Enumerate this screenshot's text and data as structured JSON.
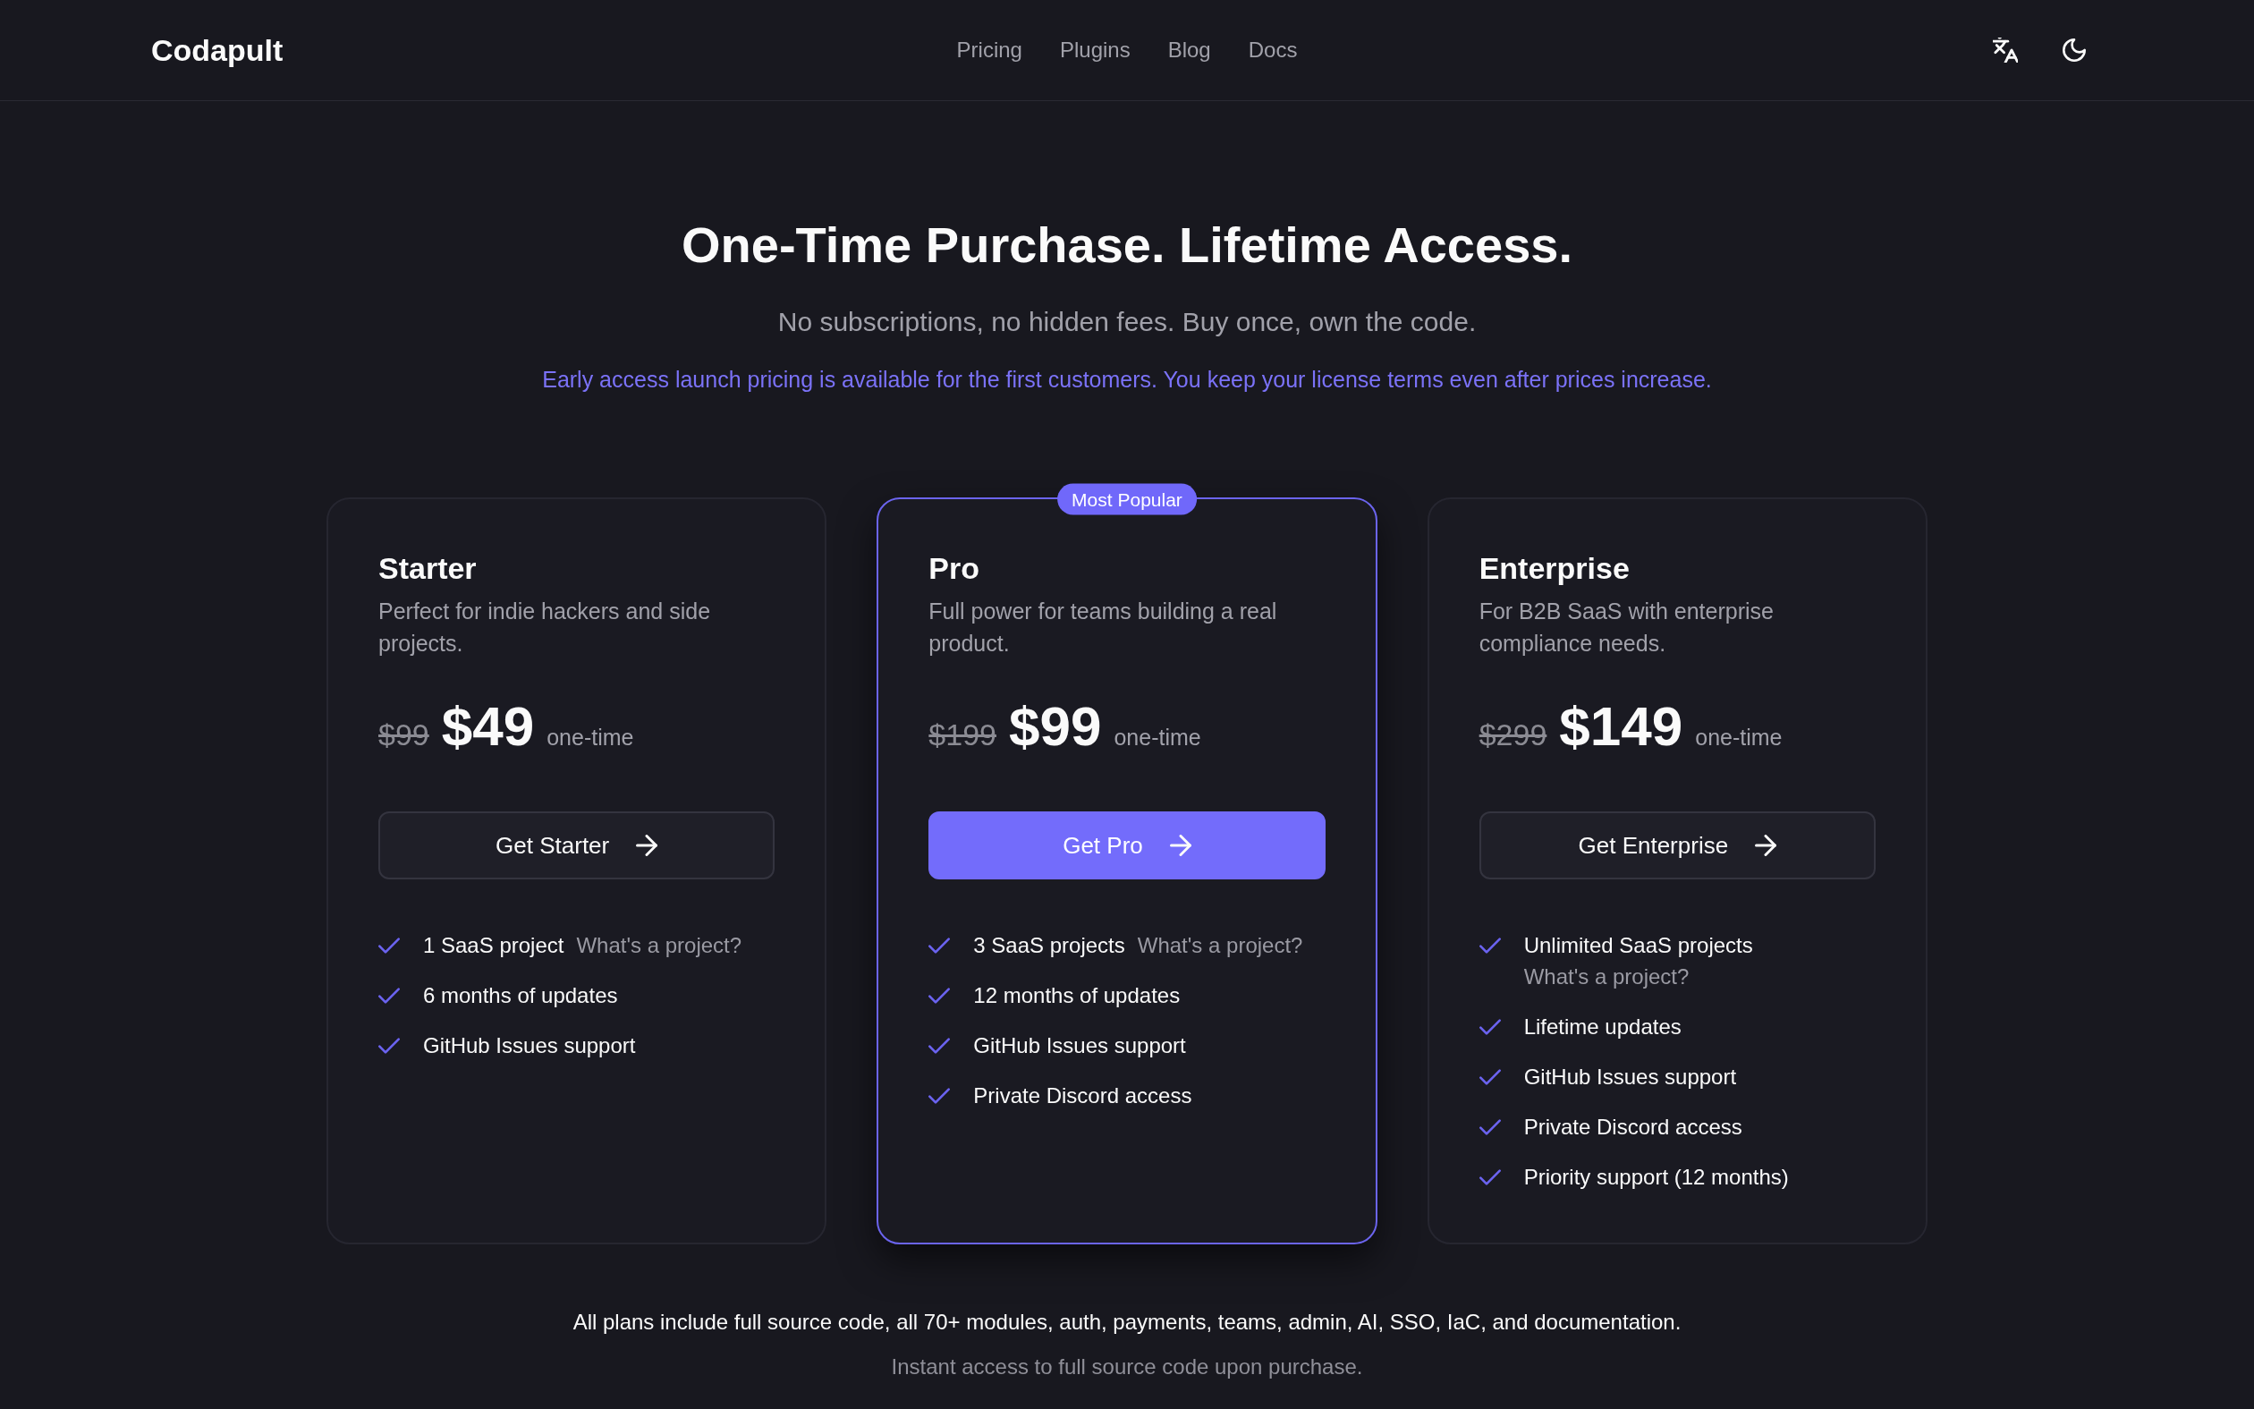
{
  "header": {
    "logo": "Codapult",
    "nav": [
      {
        "label": "Pricing"
      },
      {
        "label": "Plugins"
      },
      {
        "label": "Blog"
      },
      {
        "label": "Docs"
      }
    ]
  },
  "hero": {
    "title": "One-Time Purchase. Lifetime Access.",
    "subtitle": "No subscriptions, no hidden fees. Buy once, own the code.",
    "notice": "Early access launch pricing is available for the first customers. You keep your license terms even after prices increase."
  },
  "plans": [
    {
      "name": "Starter",
      "description": "Perfect for indie hackers and side projects.",
      "old_price": "$99",
      "price": "$49",
      "price_note": "one-time",
      "button": "Get Starter",
      "featured": false,
      "features": [
        {
          "text": "1 SaaS project",
          "help": "What's a project?"
        },
        {
          "text": "6 months of updates"
        },
        {
          "text": "GitHub Issues support"
        }
      ]
    },
    {
      "name": "Pro",
      "badge": "Most Popular",
      "description": "Full power for teams building a real product.",
      "old_price": "$199",
      "price": "$99",
      "price_note": "one-time",
      "button": "Get Pro",
      "featured": true,
      "features": [
        {
          "text": "3 SaaS projects",
          "help": "What's a project?"
        },
        {
          "text": "12 months of updates"
        },
        {
          "text": "GitHub Issues support"
        },
        {
          "text": "Private Discord access"
        }
      ]
    },
    {
      "name": "Enterprise",
      "description": "For B2B SaaS with enterprise compliance needs.",
      "old_price": "$299",
      "price": "$149",
      "price_note": "one-time",
      "button": "Get Enterprise",
      "featured": false,
      "features": [
        {
          "text": "Unlimited SaaS projects",
          "help": "What's a project?"
        },
        {
          "text": "Lifetime updates"
        },
        {
          "text": "GitHub Issues support"
        },
        {
          "text": "Private Discord access"
        },
        {
          "text": "Priority support (12 months)"
        }
      ]
    }
  ],
  "footer": {
    "note": "All plans include full source code, all 70+ modules, auth, payments, teams, admin, AI, SSO, IaC, and documentation.",
    "subnote": "Instant access to full source code upon purchase."
  }
}
